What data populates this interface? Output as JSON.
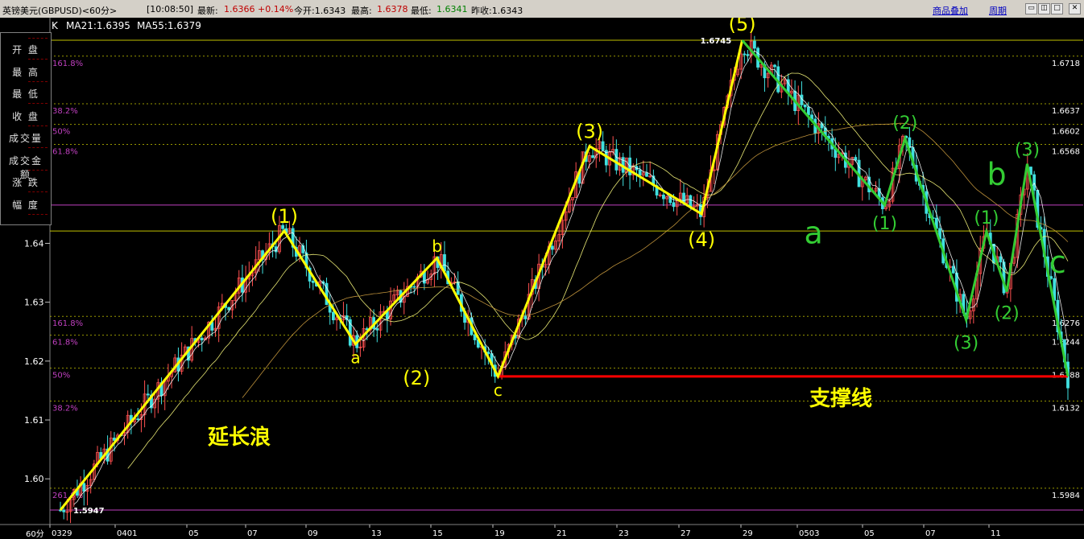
{
  "topbar": {
    "instrument": "英镑美元(GBPUSD)<60分>",
    "time": "[10:08:50]",
    "latest_label": "最新:",
    "latest_value": "1.6366",
    "change": "+0.14%",
    "open_label": "今开:1.6343",
    "high_label": "最高:",
    "high_value": "1.6378",
    "low_label": "最低:",
    "low_value": "1.6341",
    "prev_close": "昨收:1.6343",
    "overlay_link": "商品叠加",
    "period_link": "周期"
  },
  "ma_legend": {
    "k": "K",
    "ma21": "MA21:1.6395",
    "ma55": "MA55:1.6379"
  },
  "left_panel": {
    "items": [
      "开  盘",
      "最  高",
      "最  低",
      "收  盘",
      "成交量",
      "成交金额",
      "涨  跌",
      "幅  度"
    ],
    "dashes": "-----"
  },
  "colors": {
    "yellow_wave": "#ffff00",
    "green_wave": "#33cc33",
    "support": "#ff0000",
    "fib": "#c040c0",
    "grid": "#c0c000",
    "price_axis": "#ffffff"
  },
  "chart_data": {
    "type": "line",
    "instrument": "GBPUSD",
    "period_label": "60分",
    "x_ticks": [
      "0329",
      "0401",
      "05",
      "07",
      "09",
      "13",
      "15",
      "19",
      "21",
      "23",
      "27",
      "29",
      "0503",
      "05",
      "07",
      "11"
    ],
    "y_ticks": [
      "1.64",
      "1.63",
      "1.62",
      "1.61",
      "1.60"
    ],
    "ylim": [
      1.5947,
      1.6745
    ],
    "fib_left": [
      {
        "label": "161.8%",
        "price": 1.6718
      },
      {
        "label": "38.2%",
        "price": 1.6637
      },
      {
        "label": "50%",
        "price": 1.6602
      },
      {
        "label": "61.8%",
        "price": 1.6568
      },
      {
        "label": "161.8%",
        "price": 1.6276
      },
      {
        "label": "61.8%",
        "price": 1.6244
      },
      {
        "label": "50%",
        "price": 1.6188
      },
      {
        "label": "38.2%",
        "price": 1.6132
      },
      {
        "label": "261.8%",
        "price": 1.5984
      }
    ],
    "fib_right": [
      "1.6718",
      "1.6637",
      "1.6602",
      "1.6568",
      "1.6276",
      "1.6244",
      "1.6188",
      "1.6132",
      "1.5984"
    ],
    "horizontal_lines": [
      1.6745,
      1.6465,
      1.6421,
      1.5947
    ],
    "extreme_labels": [
      {
        "text": "1.6745",
        "price": 1.6745
      },
      {
        "text": "1.5947",
        "price": 1.5947
      }
    ],
    "support": {
      "label": "支撑线",
      "price": 1.6174
    },
    "yellow_wave": [
      {
        "x": 0,
        "y": 1.5947,
        "label": ""
      },
      {
        "x": 22,
        "y": 1.6421,
        "label": "(1)"
      },
      {
        "x": 29,
        "y": 1.6229,
        "label": "a"
      },
      {
        "x": 37,
        "y": 1.6375,
        "label": "b"
      },
      {
        "x": 43,
        "y": 1.6174,
        "label": "c"
      },
      {
        "x": 52,
        "y": 1.6565,
        "label": "(3)"
      },
      {
        "x": 63,
        "y": 1.645,
        "label": "(4)"
      },
      {
        "x": 67,
        "y": 1.6745,
        "label": "(5)"
      }
    ],
    "yellow_labels_extra": [
      {
        "text": "(2)",
        "x": 35,
        "y": 1.616
      }
    ],
    "wave_note": "延长浪",
    "green_wave": [
      {
        "x": 67,
        "y": 1.6745,
        "label": ""
      },
      {
        "x": 81,
        "y": 1.6465,
        "label": "(1)"
      },
      {
        "x": 83,
        "y": 1.6578,
        "label": "(2)"
      },
      {
        "x": 89,
        "y": 1.627,
        "label": "(3)"
      },
      {
        "x": 91,
        "y": 1.642,
        "label": "(1)"
      },
      {
        "x": 93,
        "y": 1.6318,
        "label": "(2)"
      },
      {
        "x": 95,
        "y": 1.6535,
        "label": "(3)"
      },
      {
        "x": 99,
        "y": 1.6174,
        "label": ""
      }
    ],
    "green_letters": [
      {
        "text": "a",
        "x": 74,
        "y": 1.64
      },
      {
        "text": "b",
        "x": 92,
        "y": 1.65
      },
      {
        "text": "c",
        "x": 98,
        "y": 1.635
      }
    ]
  }
}
